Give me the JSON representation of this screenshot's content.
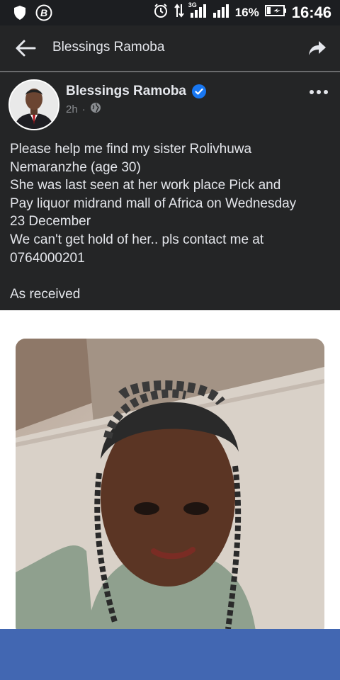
{
  "status_bar": {
    "battery_percent": "16%",
    "network_label": "3G",
    "time": "16:46",
    "icons": [
      "shield-icon",
      "b-app-icon",
      "alarm-icon",
      "data-arrows-icon",
      "signal-icon",
      "signal-icon",
      "battery-icon"
    ]
  },
  "app_bar": {
    "title": "Blessings Ramoba",
    "icons": [
      "back-arrow-icon",
      "share-icon"
    ]
  },
  "post": {
    "author": "Blessings Ramoba",
    "time": "2h",
    "separator": "·",
    "icons": [
      "verified-badge-icon",
      "globe-icon",
      "more-options-icon"
    ],
    "lines": [
      "Please help me find my sister Rolivhuwa",
      "Nemaranzhe (age 30)",
      "She was last seen at her work place Pick and",
      "Pay liquor midrand mall of Africa on Wednesday",
      "23 December",
      "We can't get hold of her.. pls contact me at",
      "0764000201"
    ],
    "footer": "As received"
  },
  "colors": {
    "status_bg": "#1c1e21",
    "post_bg": "#242526",
    "text": "#e4e6eb",
    "muted": "#8a8d91",
    "verified": "#1877f2",
    "bottom_bar": "#4267b2"
  }
}
